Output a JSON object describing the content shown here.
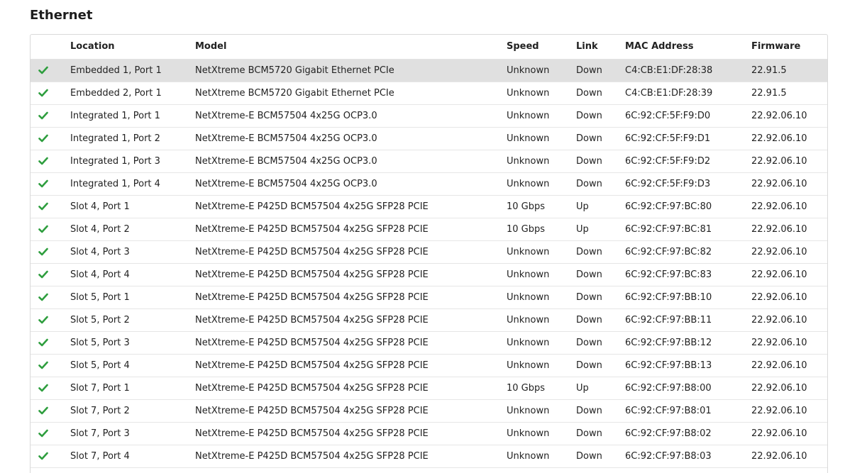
{
  "section": {
    "title": "Ethernet"
  },
  "colors": {
    "check": "#2e9e3e",
    "selected_row": "#e0e0e0"
  },
  "table": {
    "headers": {
      "location": "Location",
      "model": "Model",
      "speed": "Speed",
      "link": "Link",
      "mac": "MAC Address",
      "firmware": "Firmware"
    },
    "selected_index": 0,
    "rows": [
      {
        "status_icon": "check-icon",
        "location": "Embedded 1, Port 1",
        "model": "NetXtreme BCM5720 Gigabit Ethernet PCIe",
        "speed": "Unknown",
        "link": "Down",
        "mac": "C4:CB:E1:DF:28:38",
        "firmware": "22.91.5"
      },
      {
        "status_icon": "check-icon",
        "location": "Embedded 2, Port 1",
        "model": "NetXtreme BCM5720 Gigabit Ethernet PCIe",
        "speed": "Unknown",
        "link": "Down",
        "mac": "C4:CB:E1:DF:28:39",
        "firmware": "22.91.5"
      },
      {
        "status_icon": "check-icon",
        "location": "Integrated 1, Port 1",
        "model": "NetXtreme-E BCM57504 4x25G OCP3.0",
        "speed": "Unknown",
        "link": "Down",
        "mac": "6C:92:CF:5F:F9:D0",
        "firmware": "22.92.06.10"
      },
      {
        "status_icon": "check-icon",
        "location": "Integrated 1, Port 2",
        "model": "NetXtreme-E BCM57504 4x25G OCP3.0",
        "speed": "Unknown",
        "link": "Down",
        "mac": "6C:92:CF:5F:F9:D1",
        "firmware": "22.92.06.10"
      },
      {
        "status_icon": "check-icon",
        "location": "Integrated 1, Port 3",
        "model": "NetXtreme-E BCM57504 4x25G OCP3.0",
        "speed": "Unknown",
        "link": "Down",
        "mac": "6C:92:CF:5F:F9:D2",
        "firmware": "22.92.06.10"
      },
      {
        "status_icon": "check-icon",
        "location": "Integrated 1, Port 4",
        "model": "NetXtreme-E BCM57504 4x25G OCP3.0",
        "speed": "Unknown",
        "link": "Down",
        "mac": "6C:92:CF:5F:F9:D3",
        "firmware": "22.92.06.10"
      },
      {
        "status_icon": "check-icon",
        "location": "Slot 4, Port 1",
        "model": "NetXtreme-E P425D BCM57504 4x25G SFP28 PCIE",
        "speed": "10 Gbps",
        "link": "Up",
        "mac": "6C:92:CF:97:BC:80",
        "firmware": "22.92.06.10"
      },
      {
        "status_icon": "check-icon",
        "location": "Slot 4, Port 2",
        "model": "NetXtreme-E P425D BCM57504 4x25G SFP28 PCIE",
        "speed": "10 Gbps",
        "link": "Up",
        "mac": "6C:92:CF:97:BC:81",
        "firmware": "22.92.06.10"
      },
      {
        "status_icon": "check-icon",
        "location": "Slot 4, Port 3",
        "model": "NetXtreme-E P425D BCM57504 4x25G SFP28 PCIE",
        "speed": "Unknown",
        "link": "Down",
        "mac": "6C:92:CF:97:BC:82",
        "firmware": "22.92.06.10"
      },
      {
        "status_icon": "check-icon",
        "location": "Slot 4, Port 4",
        "model": "NetXtreme-E P425D BCM57504 4x25G SFP28 PCIE",
        "speed": "Unknown",
        "link": "Down",
        "mac": "6C:92:CF:97:BC:83",
        "firmware": "22.92.06.10"
      },
      {
        "status_icon": "check-icon",
        "location": "Slot 5, Port 1",
        "model": "NetXtreme-E P425D BCM57504 4x25G SFP28 PCIE",
        "speed": "Unknown",
        "link": "Down",
        "mac": "6C:92:CF:97:BB:10",
        "firmware": "22.92.06.10"
      },
      {
        "status_icon": "check-icon",
        "location": "Slot 5, Port 2",
        "model": "NetXtreme-E P425D BCM57504 4x25G SFP28 PCIE",
        "speed": "Unknown",
        "link": "Down",
        "mac": "6C:92:CF:97:BB:11",
        "firmware": "22.92.06.10"
      },
      {
        "status_icon": "check-icon",
        "location": "Slot 5, Port 3",
        "model": "NetXtreme-E P425D BCM57504 4x25G SFP28 PCIE",
        "speed": "Unknown",
        "link": "Down",
        "mac": "6C:92:CF:97:BB:12",
        "firmware": "22.92.06.10"
      },
      {
        "status_icon": "check-icon",
        "location": "Slot 5, Port 4",
        "model": "NetXtreme-E P425D BCM57504 4x25G SFP28 PCIE",
        "speed": "Unknown",
        "link": "Down",
        "mac": "6C:92:CF:97:BB:13",
        "firmware": "22.92.06.10"
      },
      {
        "status_icon": "check-icon",
        "location": "Slot 7, Port 1",
        "model": "NetXtreme-E P425D BCM57504 4x25G SFP28 PCIE",
        "speed": "10 Gbps",
        "link": "Up",
        "mac": "6C:92:CF:97:B8:00",
        "firmware": "22.92.06.10"
      },
      {
        "status_icon": "check-icon",
        "location": "Slot 7, Port 2",
        "model": "NetXtreme-E P425D BCM57504 4x25G SFP28 PCIE",
        "speed": "Unknown",
        "link": "Down",
        "mac": "6C:92:CF:97:B8:01",
        "firmware": "22.92.06.10"
      },
      {
        "status_icon": "check-icon",
        "location": "Slot 7, Port 3",
        "model": "NetXtreme-E P425D BCM57504 4x25G SFP28 PCIE",
        "speed": "Unknown",
        "link": "Down",
        "mac": "6C:92:CF:97:B8:02",
        "firmware": "22.92.06.10"
      },
      {
        "status_icon": "check-icon",
        "location": "Slot 7, Port 4",
        "model": "NetXtreme-E P425D BCM57504 4x25G SFP28 PCIE",
        "speed": "Unknown",
        "link": "Down",
        "mac": "6C:92:CF:97:B8:03",
        "firmware": "22.92.06.10"
      }
    ]
  }
}
